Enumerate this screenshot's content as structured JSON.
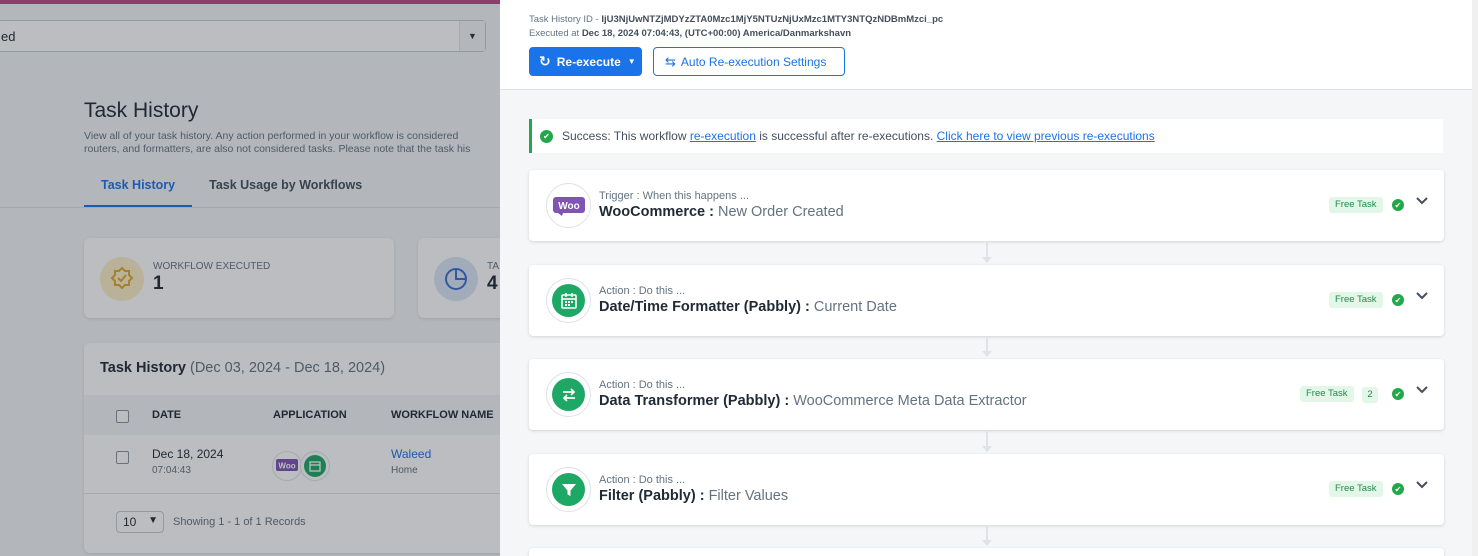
{
  "background": {
    "top_select_value": "ed",
    "page_title": "Task History",
    "description_line1": "View all of your task history. Any action performed in your workflow is considered",
    "description_line2": "routers, and formatters, are also not considered tasks. Please note that the task his",
    "tabs": [
      {
        "label": "Task History",
        "active": true
      },
      {
        "label": "Task Usage by Workflows",
        "active": false
      }
    ],
    "stats": [
      {
        "label": "WORKFLOW EXECUTED",
        "value": "1"
      },
      {
        "label": "TA",
        "value": "4"
      }
    ],
    "history": {
      "title": "Task History",
      "range": "(Dec 03, 2024 - Dec 18, 2024)",
      "columns": [
        "DATE",
        "APPLICATION",
        "WORKFLOW NAME"
      ],
      "rows": [
        {
          "date": "Dec 18, 2024",
          "time": "07:04:43",
          "workflow": "Waleed",
          "folder": "Home"
        }
      ],
      "per_page": "10",
      "showing": "Showing 1 - 1 of 1 Records"
    }
  },
  "drawer": {
    "task_history_id_label": "Task History ID -",
    "task_history_id": "IjU3NjUwNTZjMDYzZTA0Mzc1MjY5NTUzNjUxMzc1MTY3NTQzNDBmMzci_pc",
    "executed_at_label": "Executed at",
    "executed_at": "Dec 18, 2024 07:04:43, (UTC+00:00) America/Danmarkshavn",
    "reexecute_label": "Re-execute",
    "auto_reexec_label": "Auto Re-execution Settings",
    "alert": {
      "prefix": "Success: This workflow",
      "link1": "re-execution",
      "middle": "is successful after re-executions.",
      "link2": "Click here to view previous re-executions"
    },
    "steps": [
      {
        "pre": "Trigger : When this happens ...",
        "app": "WooCommerce :",
        "event": "New Order Created",
        "badge": "Free Task",
        "count": ""
      },
      {
        "pre": "Action : Do this ...",
        "app": "Date/Time Formatter (Pabbly) :",
        "event": "Current Date",
        "badge": "Free Task",
        "count": ""
      },
      {
        "pre": "Action : Do this ...",
        "app": "Data Transformer (Pabbly) :",
        "event": "WooCommerce Meta Data Extractor",
        "badge": "Free Task",
        "count": "2"
      },
      {
        "pre": "Action : Do this ...",
        "app": "Filter (Pabbly) :",
        "event": "Filter Values",
        "badge": "Free Task",
        "count": ""
      }
    ]
  },
  "colors": {
    "primary": "#1a73e8",
    "success": "#22a84a",
    "pabbly_green": "#1ea865",
    "woo_purple": "#7f54b3"
  }
}
